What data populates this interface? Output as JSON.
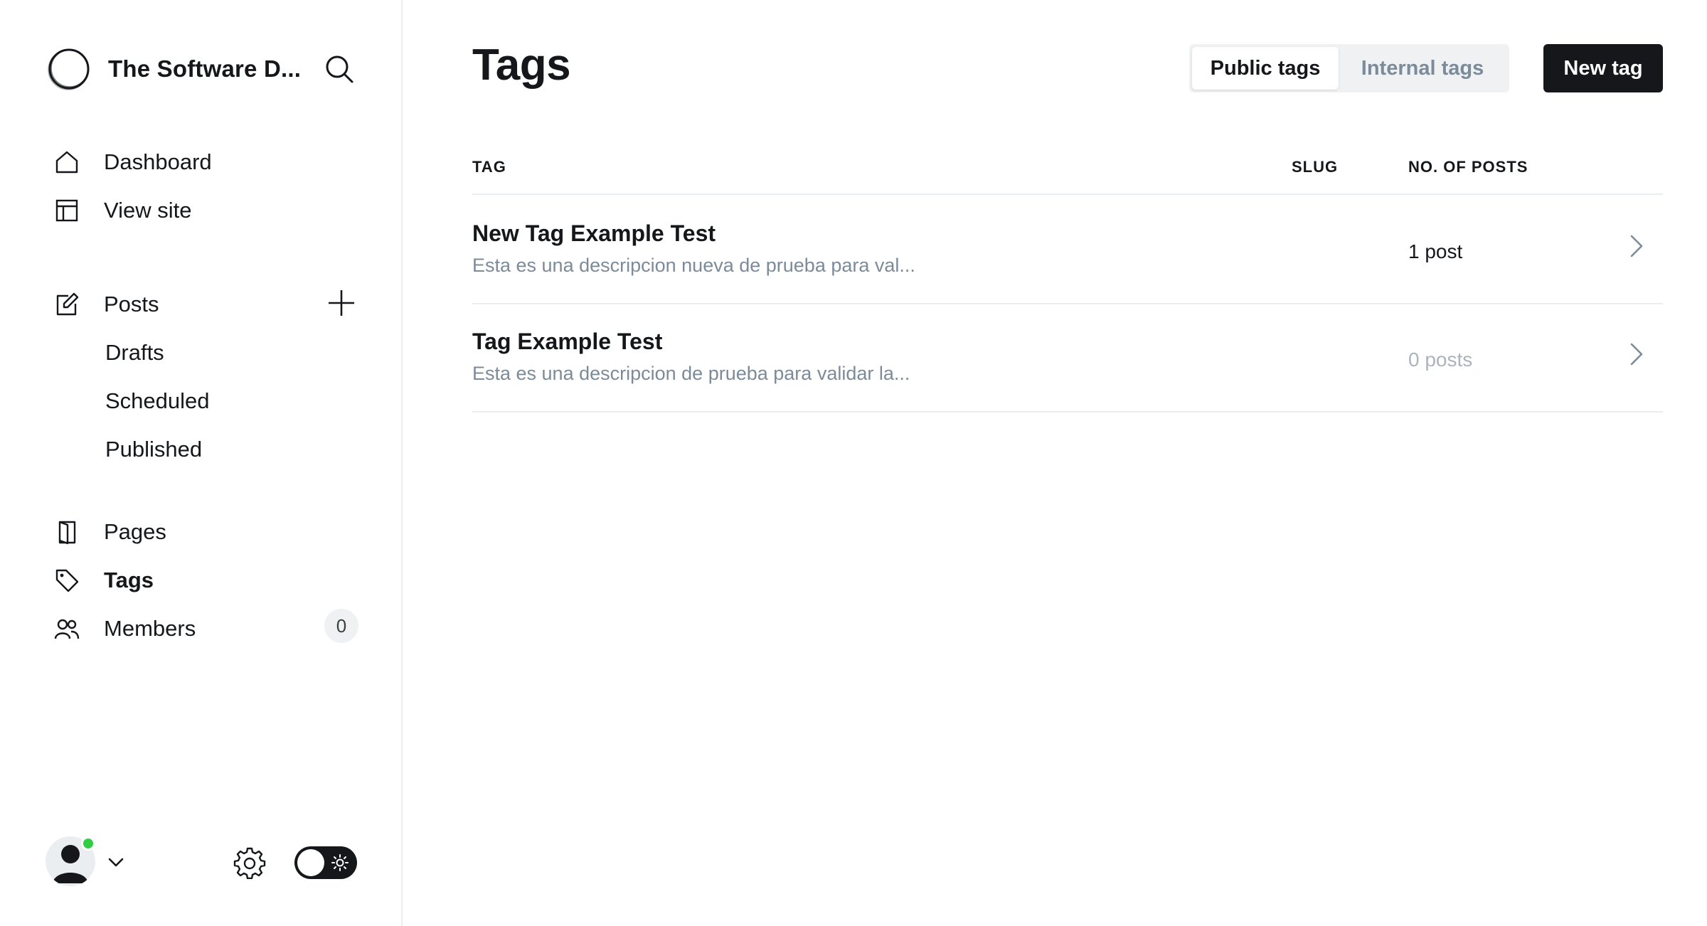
{
  "site": {
    "title": "The Software D..."
  },
  "nav": {
    "dashboard": "Dashboard",
    "view_site": "View site",
    "posts": "Posts",
    "drafts": "Drafts",
    "scheduled": "Scheduled",
    "published": "Published",
    "pages": "Pages",
    "tags": "Tags",
    "members": "Members",
    "members_count": "0",
    "active": "Tags"
  },
  "header": {
    "title": "Tags",
    "tabs": [
      {
        "label": "Public tags",
        "active": true
      },
      {
        "label": "Internal tags",
        "active": false
      }
    ],
    "new_tag_label": "New tag"
  },
  "table": {
    "columns": [
      "TAG",
      "SLUG",
      "NO. OF POSTS"
    ],
    "rows": [
      {
        "name": "New Tag Example Test",
        "description": "Esta es una descripcion nueva de prueba para val...",
        "slug": "",
        "count": "1 post"
      },
      {
        "name": "Tag Example Test",
        "description": "Esta es una descripcion de prueba para validar la...",
        "slug": "",
        "count": "0 posts"
      }
    ]
  },
  "colors": {
    "accent_dark": "#15171a",
    "muted_text": "#7c8b9a",
    "online": "#30cf43",
    "border": "#ebeef0"
  },
  "icons": [
    "site-logo-icon",
    "search-icon",
    "home-icon",
    "layout-icon",
    "edit-icon",
    "plus-icon",
    "book-icon",
    "tag-icon",
    "members-icon",
    "user-icon",
    "chevron-down-icon",
    "gear-icon",
    "sun-icon",
    "chevron-right-icon"
  ]
}
